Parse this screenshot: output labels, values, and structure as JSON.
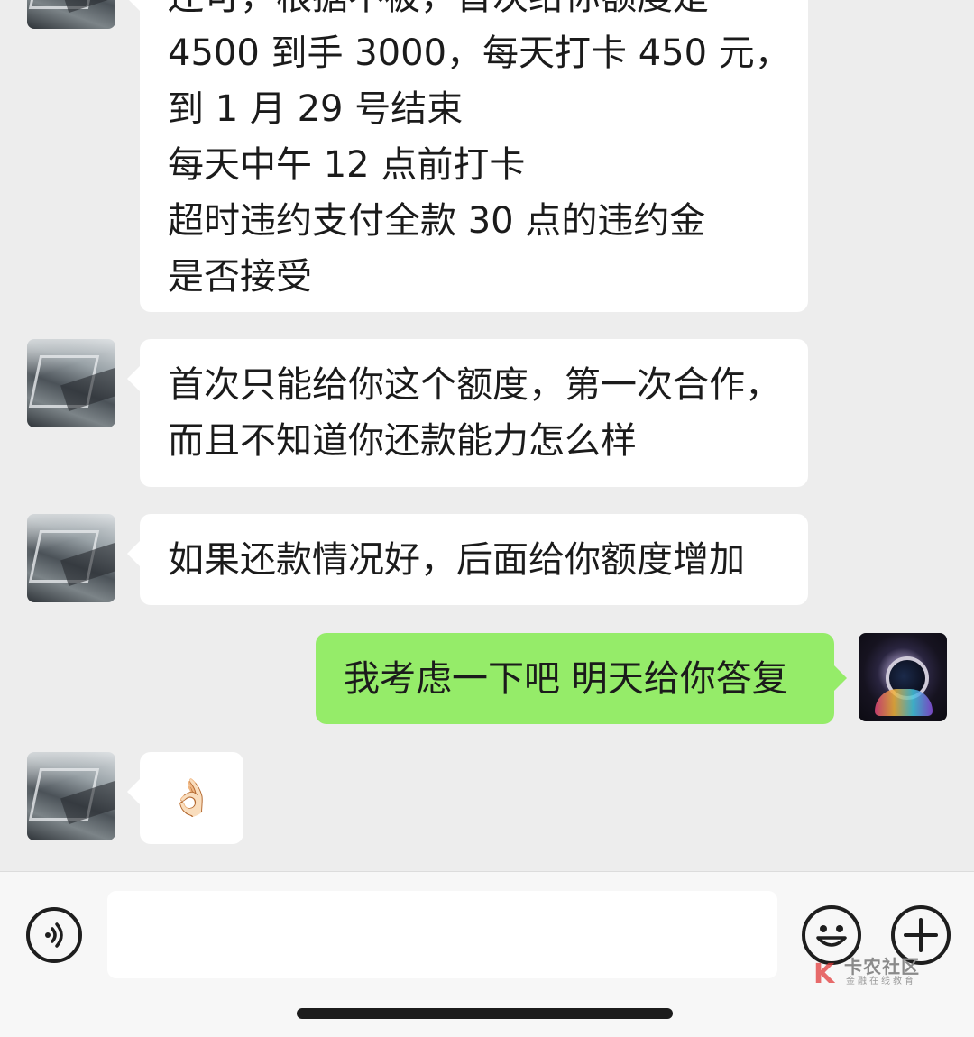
{
  "messages": [
    {
      "side": "left",
      "lines": [
        "还可，根据不被，首次给你额度是",
        "4500 到手 3000，每天打卡 450 元，",
        "到 1 月 29 号结束",
        "每天中午 12 点前打卡",
        "超时违约支付全款 30 点的违约金",
        "是否接受"
      ]
    },
    {
      "side": "left",
      "lines": [
        "首次只能给你这个额度，第一次合作，",
        "而且不知道你还款能力怎么样"
      ]
    },
    {
      "side": "left",
      "lines": [
        "如果还款情况好，后面给你额度增加"
      ]
    },
    {
      "side": "right",
      "lines": [
        "我考虑一下吧 明天给你答复"
      ]
    },
    {
      "side": "left",
      "lines": [
        "👌🏻"
      ]
    }
  ],
  "input": {
    "placeholder": ""
  },
  "icons": {
    "voice": "voice-icon",
    "emoji": "emoji-icon",
    "plus": "plus-icon"
  },
  "watermark": {
    "title": "卡农社区",
    "subtitle": "金融在线教育"
  },
  "colors": {
    "background": "#ededed",
    "bubble_left": "#ffffff",
    "bubble_right": "#95ec69"
  }
}
